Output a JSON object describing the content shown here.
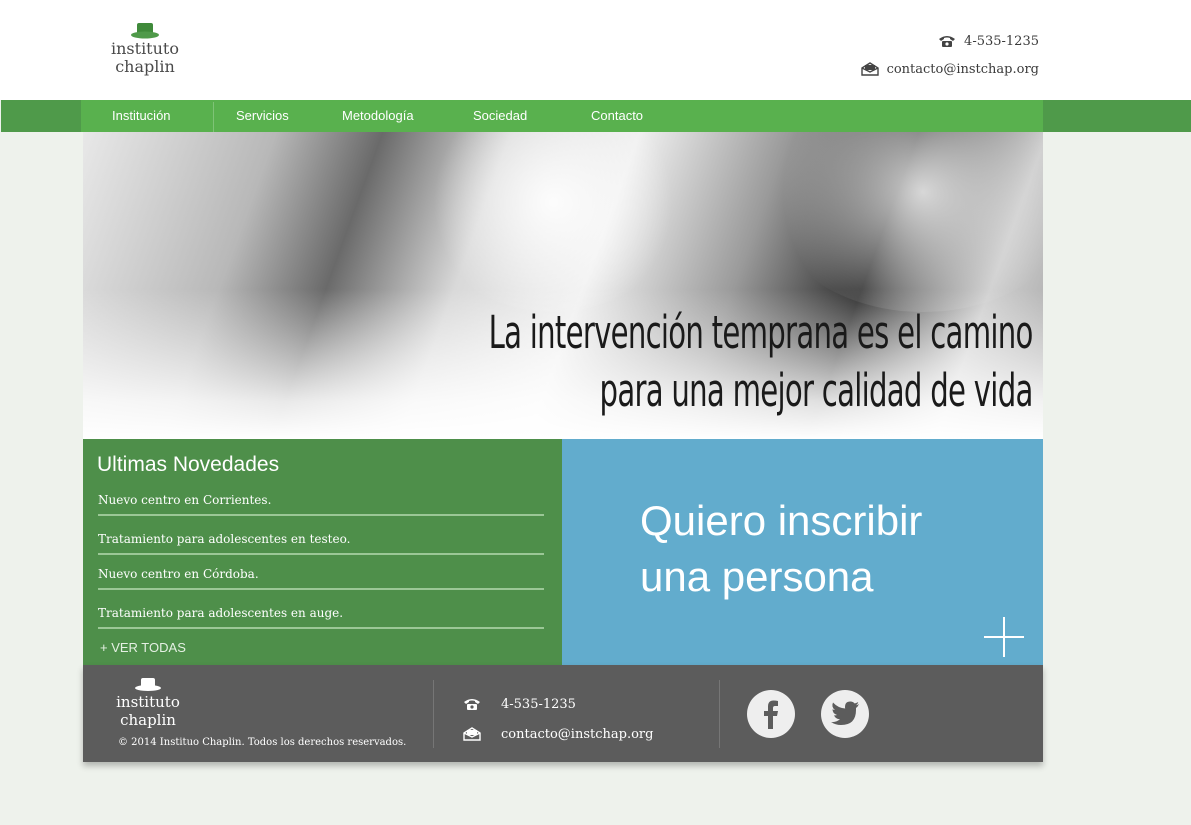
{
  "header": {
    "logo": {
      "line1": "instituto",
      "line2": "chaplin"
    },
    "phone": "4-535-1235",
    "email": "contacto@instchap.org"
  },
  "nav": {
    "items": [
      {
        "label": "Institución"
      },
      {
        "label": "Servicios"
      },
      {
        "label": "Metodología"
      },
      {
        "label": "Sociedad"
      },
      {
        "label": "Contacto"
      }
    ]
  },
  "hero": {
    "line1": "La intervención temprana es el camino",
    "line2": "para una mejor calidad de vida"
  },
  "news": {
    "title": "Ultimas Novedades",
    "items": [
      {
        "text": "Nuevo centro en Corrientes."
      },
      {
        "text": "Tratamiento para adolescentes en testeo."
      },
      {
        "text": "Nuevo centro en Córdoba."
      },
      {
        "text": "Tratamiento para adolescentes en auge."
      }
    ],
    "more": "+ VER TODAS"
  },
  "enroll": {
    "line1": "Quiero inscribir",
    "line2": "una persona"
  },
  "footer": {
    "logo": {
      "line1": "instituto",
      "line2": "chaplin"
    },
    "copyright": "© 2014 Instituo Chaplin. Todos los derechos reservados.",
    "phone": "4-535-1235",
    "email": "contacto@instchap.org",
    "social": [
      {
        "icon": "facebook-icon"
      },
      {
        "icon": "twitter-icon"
      }
    ]
  },
  "colors": {
    "nav_green": "#59b14e",
    "news_green": "#4e8f4a",
    "enroll_blue": "#62accd",
    "footer_gray": "#5c5c5c",
    "page_bg": "#eef2ec"
  }
}
